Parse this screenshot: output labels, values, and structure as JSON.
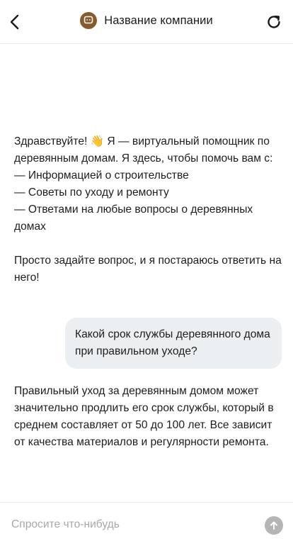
{
  "header": {
    "title": "Название компании",
    "back_icon": "chevron-left-icon",
    "refresh_icon": "refresh-icon",
    "logo_icon": "chat-bubble-logo-icon",
    "logo_color": "#8a5a2b"
  },
  "messages": [
    {
      "role": "bot",
      "text": "Здравствуйте! 👋 Я — виртуальный помощник по деревянным домам. Я здесь, чтобы помочь вам с:\n— Информацией о строительстве\n— Советы по уходу и ремонту\n— Ответами на любые вопросы о деревянных домах\n\nПросто задайте вопрос, и я постараюсь ответить на него!"
    },
    {
      "role": "user",
      "text": "Какой срок службы деревянного дома при правильном уходе?"
    },
    {
      "role": "bot",
      "text": "Правильный уход за деревянным домом может значительно продлить его срок службы, который в среднем составляет от 50 до 100 лет. Все зависит от качества материалов и регулярности ремонта."
    }
  ],
  "composer": {
    "placeholder": "Спросите что-нибудь",
    "value": "",
    "send_icon": "arrow-up-icon"
  },
  "colors": {
    "user_bubble": "#eceff1",
    "send_button": "#b5b5b5",
    "placeholder": "#a8a8a8"
  }
}
